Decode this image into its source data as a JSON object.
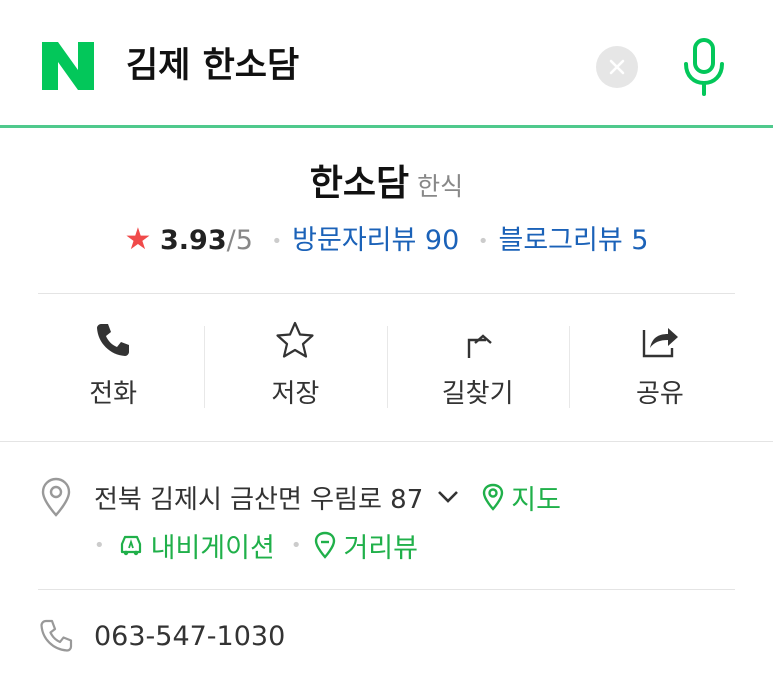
{
  "search": {
    "logo_letter": "N",
    "query": "김제 한소담",
    "clear_icon": "close-icon",
    "mic_icon": "mic-icon",
    "accent_color": "#03c75a"
  },
  "place": {
    "name": "한소담",
    "category": "한식",
    "rating": {
      "star": "★",
      "score": "3.93",
      "max": "/5"
    },
    "visitor_reviews": "방문자리뷰 90",
    "blog_reviews": "블로그리뷰 5"
  },
  "actions": [
    {
      "label": "전화",
      "icon": "phone-icon"
    },
    {
      "label": "저장",
      "icon": "star-outline-icon"
    },
    {
      "label": "길찾기",
      "icon": "directions-icon"
    },
    {
      "label": "공유",
      "icon": "share-icon"
    }
  ],
  "address": {
    "text": "전북 김제시 금산면 우림로 87",
    "map_link": "지도",
    "navigation_link": "내비게이션",
    "street_view_link": "거리뷰"
  },
  "phone": {
    "number": "063-547-1030"
  }
}
